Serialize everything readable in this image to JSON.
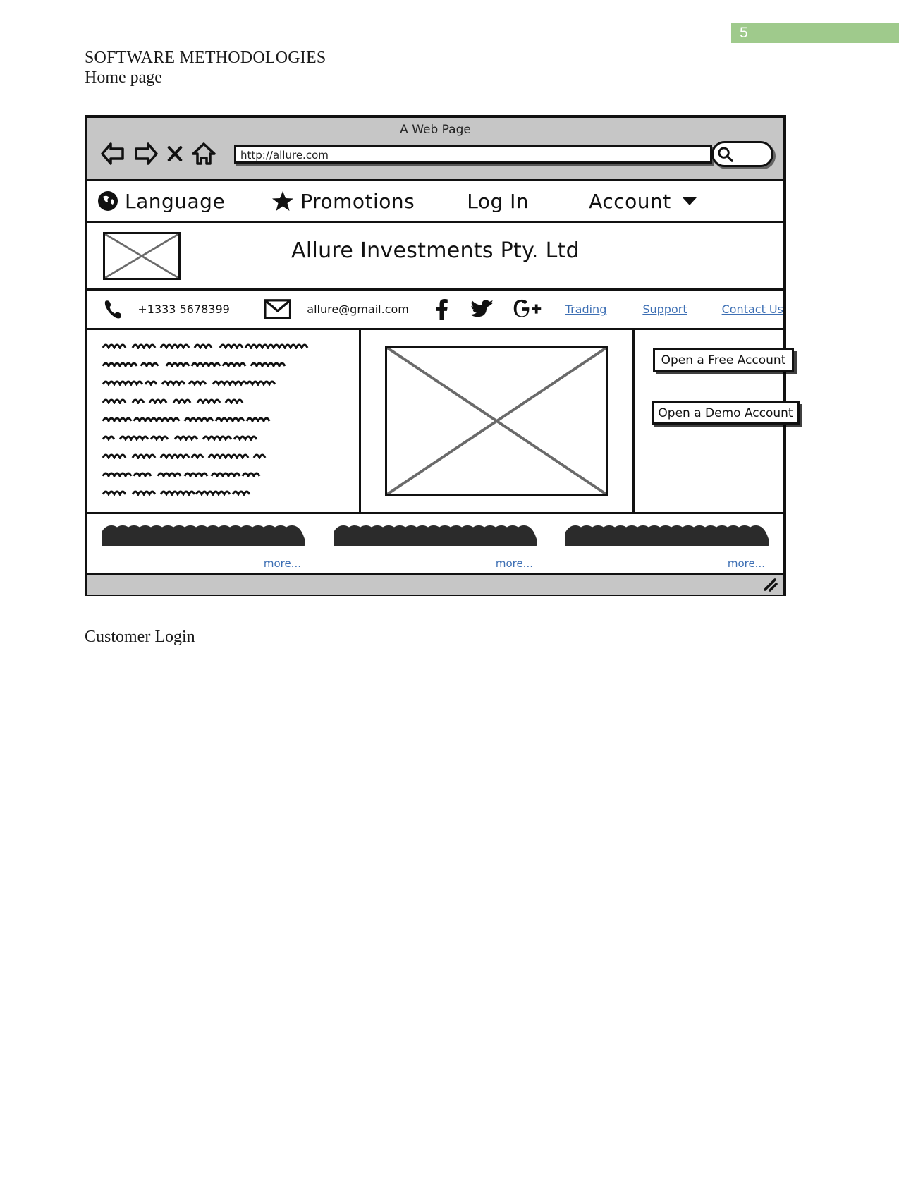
{
  "document": {
    "page_number": "5",
    "title": "SOFTWARE METHODOLOGIES",
    "subtitle": "Home page",
    "footnote": "Customer Login",
    "badge_color": "#9fca8c"
  },
  "browser": {
    "window_title": "A Web Page",
    "url_value": "http://allure.com",
    "controls": [
      {
        "name": "back-icon",
        "label": "Back"
      },
      {
        "name": "forward-icon",
        "label": "Forward"
      },
      {
        "name": "stop-icon",
        "label": "Stop"
      },
      {
        "name": "home-icon",
        "label": "Home"
      }
    ],
    "search_icon": "search-icon"
  },
  "site": {
    "topnav": [
      {
        "icon": "globe-icon",
        "label": "Language"
      },
      {
        "icon": "star-icon",
        "label": "Promotions"
      },
      {
        "icon": "",
        "label": "Log In"
      },
      {
        "icon": "chevron-down-icon",
        "label": "Account"
      }
    ],
    "brand": {
      "logo": "image-placeholder",
      "name": "Allure Investments Pty. Ltd"
    },
    "contact": {
      "phone_icon": "phone-icon",
      "phone": "+1333 5678399",
      "mail_icon": "envelope-icon",
      "email": "allure@gmail.com",
      "social": [
        "facebook-icon",
        "twitter-icon",
        "google-plus-icon"
      ],
      "links": [
        "Trading",
        "Support",
        "Contact Us"
      ],
      "link_color": "#3d6fb4"
    },
    "hero": {
      "text_placeholder_lines": 9,
      "image_placeholder": "image-placeholder",
      "buttons": [
        {
          "label": "Open a Free Account"
        },
        {
          "label": "Open a Demo Account"
        }
      ]
    },
    "teasers": [
      {
        "scribble": "scribble-placeholder",
        "more_label": "more..."
      },
      {
        "scribble": "scribble-placeholder",
        "more_label": "more..."
      },
      {
        "scribble": "scribble-placeholder",
        "more_label": "more..."
      }
    ],
    "resize_grip_icon": "resize-grip-icon"
  }
}
